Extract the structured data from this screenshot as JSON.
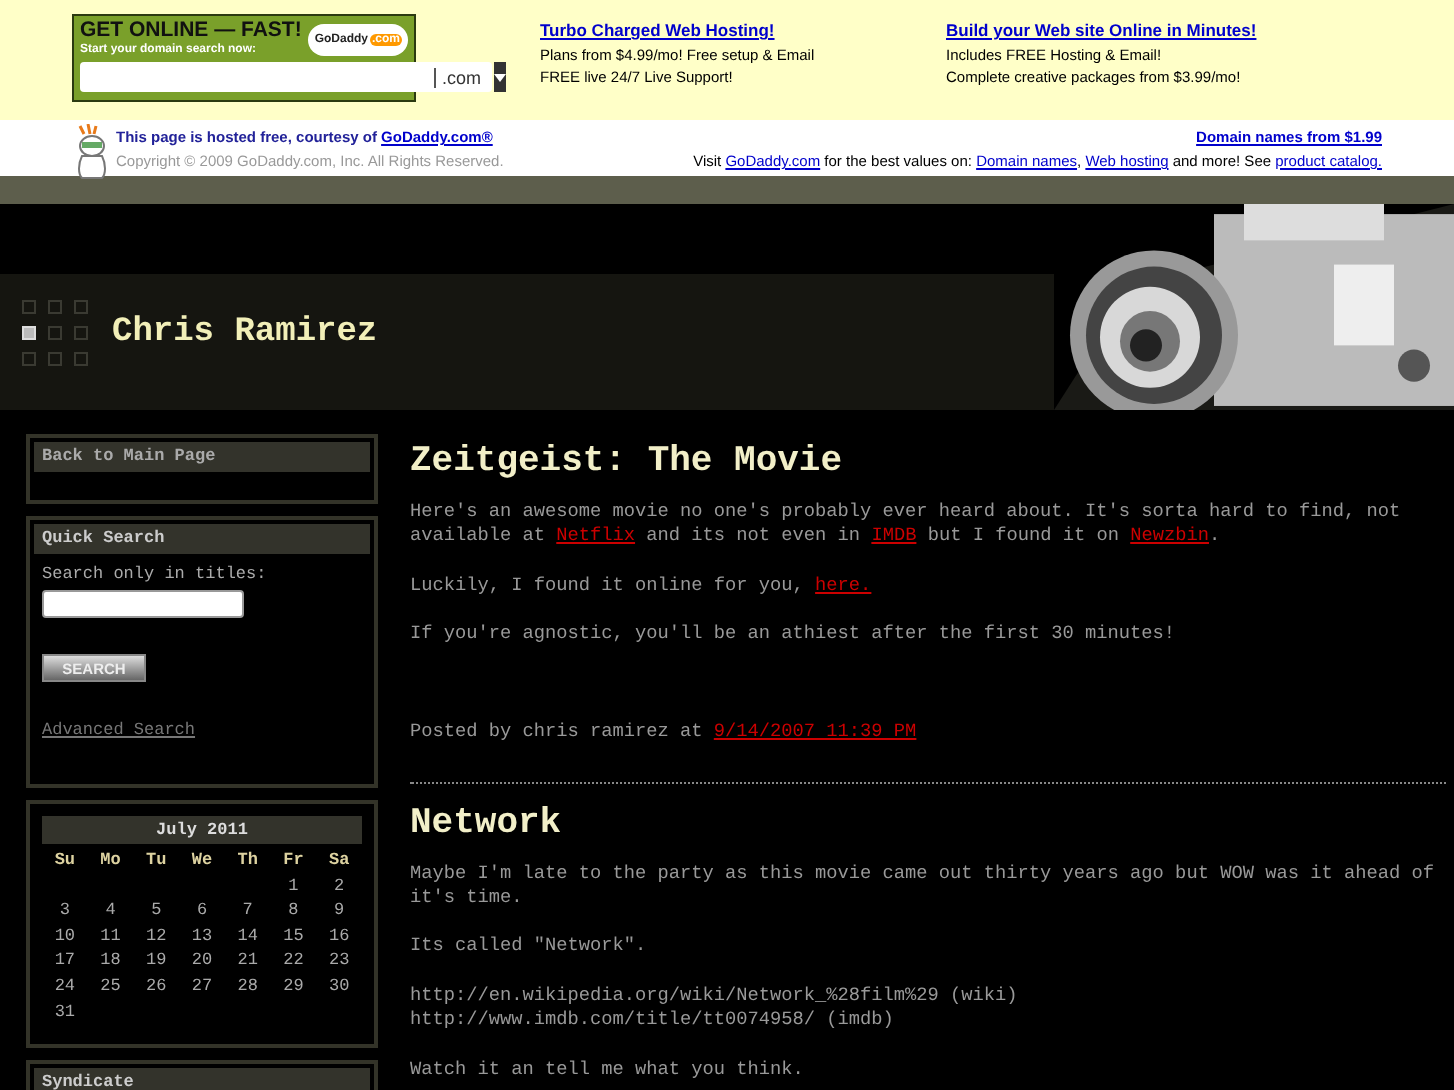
{
  "ad_banner": {
    "domain_box": {
      "headline": "GET ONLINE — FAST!",
      "subline": "Start your domain search now:",
      "logo": "GoDaddy",
      "logo_suffix": ".com",
      "extension": ".com"
    },
    "offers": [
      {
        "title": "Turbo Charged Web Hosting!",
        "lines": [
          "Plans from $4.99/mo! Free setup & Email",
          "FREE live 24/7 Live Support!"
        ]
      },
      {
        "title": "Build your Web site Online in Minutes!",
        "lines": [
          "Includes FREE Hosting & Email!",
          "Complete creative packages from $3.99/mo!"
        ]
      }
    ]
  },
  "host_bar": {
    "hosted": [
      {
        "kind": "text",
        "text": "This page is hosted free, courtesy of "
      },
      {
        "kind": "link",
        "text": "GoDaddy.com®"
      }
    ],
    "copyright": "Copyright © 2009 GoDaddy.com, Inc. All Rights Reserved.",
    "domain_link": "Domain names from $1.99",
    "visit": [
      {
        "kind": "text",
        "text": "Visit "
      },
      {
        "kind": "link",
        "text": "GoDaddy.com"
      },
      {
        "kind": "text",
        "text": " for the best values on: "
      },
      {
        "kind": "link",
        "text": "Domain names"
      },
      {
        "kind": "text",
        "text": ", "
      },
      {
        "kind": "link",
        "text": "Web hosting"
      },
      {
        "kind": "text",
        "text": " and more! See "
      },
      {
        "kind": "link",
        "text": "product catalog."
      }
    ]
  },
  "header": {
    "title": "Chris Ramirez"
  },
  "sidebar": {
    "back_link": "Back to Main Page",
    "search": {
      "heading": "Quick Search",
      "label": "Search only in titles:",
      "button": "SEARCH",
      "advanced": "Advanced Search"
    },
    "calendar": {
      "month": "July 2011",
      "weekdays": [
        "Su",
        "Mo",
        "Tu",
        "We",
        "Th",
        "Fr",
        "Sa"
      ],
      "weeks": [
        {
          "kind": "partial_start",
          "days": [
            "1",
            "2"
          ]
        },
        {
          "kind": "full",
          "days": [
            "3",
            "4",
            "5",
            "6",
            "7",
            "8",
            "9"
          ]
        },
        {
          "kind": "full",
          "days": [
            "10",
            "11",
            "12",
            "13",
            "14",
            "15",
            "16"
          ]
        },
        {
          "kind": "full",
          "days": [
            "17",
            "18",
            "19",
            "20",
            "21",
            "22",
            "23"
          ]
        },
        {
          "kind": "full",
          "days": [
            "24",
            "25",
            "26",
            "27",
            "28",
            "29",
            "30"
          ]
        },
        {
          "kind": "partial_end",
          "days": [
            "31"
          ]
        }
      ]
    },
    "syndicate": "Syndicate"
  },
  "posts": [
    {
      "title": "Zeitgeist: The Movie",
      "paragraphs": [
        [
          {
            "kind": "text",
            "text": "Here's an awesome movie no one's probably ever heard about. It's sorta hard to find, not available at "
          },
          {
            "kind": "link",
            "text": "Netflix"
          },
          {
            "kind": "text",
            "text": " and its not even in "
          },
          {
            "kind": "link",
            "text": "IMDB"
          },
          {
            "kind": "text",
            "text": " but I found it on "
          },
          {
            "kind": "link",
            "text": "Newzbin"
          },
          {
            "kind": "text",
            "text": "."
          }
        ],
        [
          {
            "kind": "text",
            "text": "Luckily, I found it online for you, "
          },
          {
            "kind": "link",
            "text": "here."
          }
        ],
        [
          {
            "kind": "text",
            "text": "If you're agnostic, you'll be an athiest after the first 30 minutes!"
          }
        ]
      ],
      "footer": [
        {
          "kind": "text",
          "text": "Posted by chris ramirez at "
        },
        {
          "kind": "link",
          "text": "9/14/2007 11:39 PM"
        }
      ]
    },
    {
      "title": "Network",
      "paragraphs": [
        [
          {
            "kind": "text",
            "text": "Maybe I'm late to the party as this movie came out thirty years ago but WOW was it ahead of it's time."
          }
        ],
        [
          {
            "kind": "text",
            "text": "Its called \"Network\"."
          }
        ],
        [
          {
            "kind": "text",
            "text": "http://en.wikipedia.org/wiki/Network_%28film%29 (wiki)"
          },
          {
            "kind": "text",
            "text": "http://www.imdb.com/title/tt0074958/ (imdb)",
            "new_line": true
          }
        ],
        [
          {
            "kind": "text",
            "text": "Watch it an tell me what you think."
          }
        ]
      ]
    }
  ]
}
